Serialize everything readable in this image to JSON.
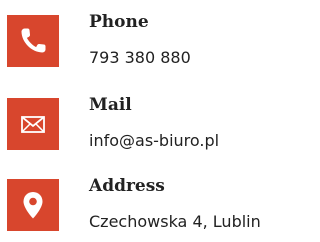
{
  "colors": {
    "accent": "#d8462d",
    "text": "#222222",
    "icon_foreground": "#ffffff"
  },
  "contacts": [
    {
      "icon": "phone-icon",
      "title": "Phone",
      "value": "793 380 880"
    },
    {
      "icon": "mail-icon",
      "title": "Mail",
      "value": "info@as-biuro.pl"
    },
    {
      "icon": "location-pin-icon",
      "title": "Address",
      "value": "Czechowska 4, Lublin"
    }
  ]
}
